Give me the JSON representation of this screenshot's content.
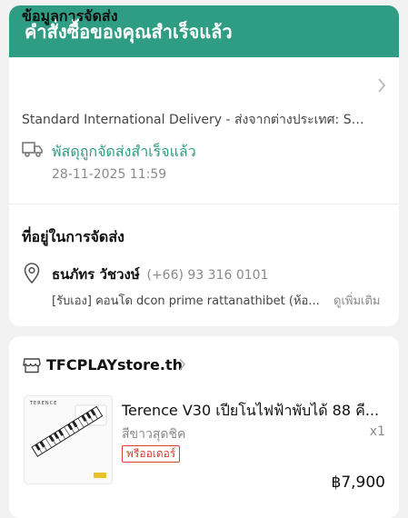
{
  "order": {
    "banner_title": "คำสั่งซื้อของคุณสำเร็จแล้ว",
    "shipping_info": {
      "title": "ข้อมูลการจัดส่ง",
      "method": "Standard International Delivery - ส่งจากต่างประเทศ: SP...",
      "status": "พัสดุถูกจัดส่งสำเร็จแล้ว",
      "timestamp": "28-11-2025 11:59"
    },
    "address": {
      "title": "ที่อยู่ในการจัดส่ง",
      "name": "ธนภัทร วัชวงษ์",
      "phone": "(+66) 93 316 0101",
      "line": "[รับเอง] คอนโด dcon prime rattanathibet (ห้อ...",
      "more_label": "ดูเพิ่มเติม"
    }
  },
  "shop": {
    "name": "TFCPLAYstore.th",
    "product": {
      "brand_text": "TERENCE",
      "title": "Terence V30 เปียโนไฟฟ้าพับได้ 88 คี...",
      "variant": "สีขาวสุดชิค",
      "qty": "x1",
      "badge": "พรีออเดอร์",
      "price": "฿7,900"
    }
  },
  "colors": {
    "accent": "#2e9d84",
    "badge": "#d9412c"
  },
  "icons": [
    "truck-icon",
    "location-pin-icon",
    "store-icon",
    "chevron-right-icon"
  ]
}
